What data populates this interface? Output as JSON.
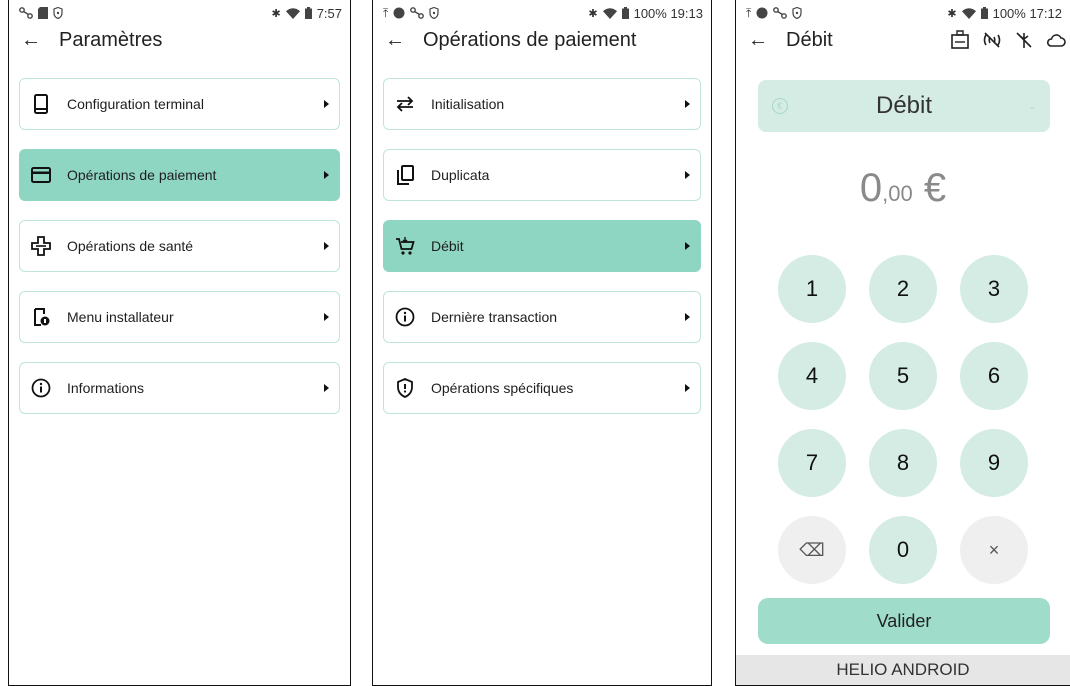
{
  "screens": [
    {
      "status": {
        "time": "7:57"
      },
      "title": "Paramètres",
      "items": [
        {
          "label": "Configuration terminal",
          "icon": "phone-device-icon"
        },
        {
          "label": "Opérations de paiement",
          "icon": "credit-card-icon",
          "active": true
        },
        {
          "label": "Opérations de santé",
          "icon": "health-cross-icon"
        },
        {
          "label": "Menu installateur",
          "icon": "installer-icon"
        },
        {
          "label": "Informations",
          "icon": "info-icon"
        }
      ]
    },
    {
      "status": {
        "time": "100% 19:13"
      },
      "title": "Opérations de paiement",
      "items": [
        {
          "label": "Initialisation",
          "icon": "swap-arrows-icon"
        },
        {
          "label": "Duplicata",
          "icon": "copy-icon"
        },
        {
          "label": "Débit",
          "icon": "cart-icon",
          "active": true
        },
        {
          "label": "Dernière transaction",
          "icon": "info-icon"
        },
        {
          "label": "Opérations spécifiques",
          "icon": "shield-icon"
        }
      ]
    },
    {
      "status": {
        "time": "100% 17:12"
      },
      "title": "Débit",
      "operation": "Débit",
      "amount_int": "0",
      "amount_dec": ",00",
      "currency": "€",
      "keys": [
        "1",
        "2",
        "3",
        "4",
        "5",
        "6",
        "7",
        "8",
        "9",
        "⌫",
        "0",
        "×"
      ],
      "validate_label": "Valider",
      "footer": "HELIO ANDROID"
    }
  ],
  "colors": {
    "accent": "#8fd6c2",
    "soft": "#d4ece4",
    "border": "#bfe5d8"
  }
}
